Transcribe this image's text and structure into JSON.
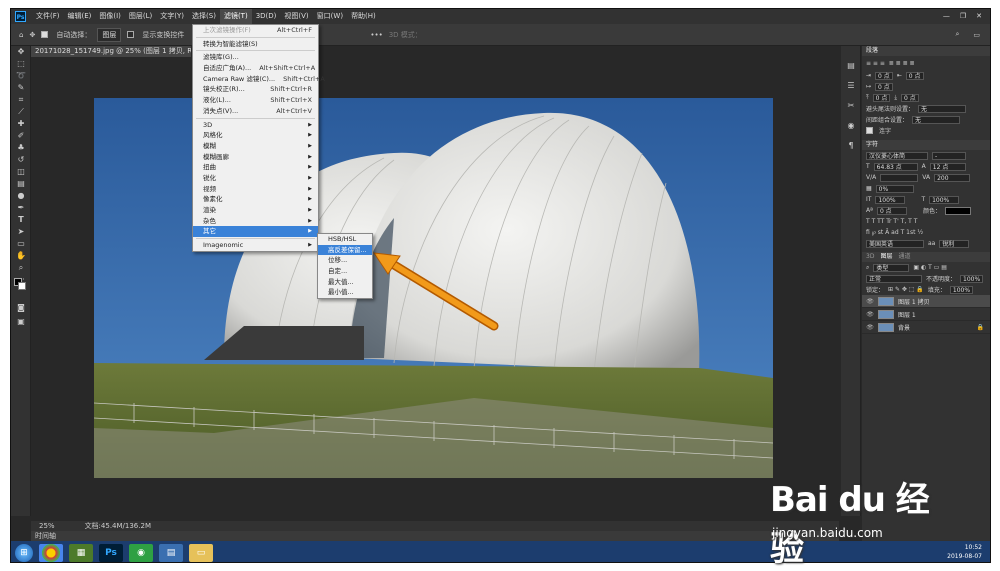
{
  "menubar": {
    "items": [
      "文件(F)",
      "编辑(E)",
      "图像(I)",
      "图层(L)",
      "文字(Y)",
      "选择(S)",
      "滤镜(T)",
      "3D(D)",
      "视图(V)",
      "窗口(W)",
      "帮助(H)"
    ],
    "active": "滤镜(T)"
  },
  "options": {
    "auto_select_label": "自动选择：",
    "auto_select_value": "图层",
    "transform_label": "显示变换控件",
    "mode_3d": "3D 模式："
  },
  "document": {
    "tab_title": "20171028_151749.jpg @ 25% (图层 1 拷贝, RGB/8) *",
    "zoom": "25%",
    "doc_info": "文档:45.4M/136.2M"
  },
  "timeline_label": "时间轴",
  "filter_menu": {
    "top": [
      {
        "label": "上次滤镜操作(F)",
        "shortcut": "Alt+Ctrl+F",
        "disabled": true
      },
      {
        "label": "转换为智能滤镜(S)",
        "shortcut": ""
      }
    ],
    "mid": [
      {
        "label": "滤镜库(G)...",
        "shortcut": ""
      },
      {
        "label": "自适应广角(A)...",
        "shortcut": "Alt+Shift+Ctrl+A"
      },
      {
        "label": "Camera Raw 滤镜(C)...",
        "shortcut": "Shift+Ctrl+A"
      },
      {
        "label": "镜头校正(R)...",
        "shortcut": "Shift+Ctrl+R"
      },
      {
        "label": "液化(L)...",
        "shortcut": "Shift+Ctrl+X"
      },
      {
        "label": "消失点(V)...",
        "shortcut": "Alt+Ctrl+V"
      }
    ],
    "groups": [
      "3D",
      "风格化",
      "模糊",
      "模糊画廊",
      "扭曲",
      "锐化",
      "视频",
      "像素化",
      "渲染",
      "杂色",
      "其它"
    ],
    "plugin": "Imagenomic"
  },
  "other_submenu": {
    "items": [
      "HSB/HSL",
      "高反差保留...",
      "位移...",
      "自定...",
      "最大值...",
      "最小值..."
    ],
    "highlighted": "高反差保留..."
  },
  "paragraph_panel": {
    "title": "段落",
    "fields": [
      "0 点",
      "0 点",
      "0 点",
      "0 点",
      "0 点"
    ],
    "hyphen_label": "避头尾法则设置：",
    "hyphen_value": "无",
    "spacing_label": "间距组合设置：",
    "spacing_value": "无",
    "auto_hyphen": "连字"
  },
  "character_panel": {
    "title": "字符",
    "font": "汉仪菱心体简",
    "style": "-",
    "size": "64.83 点",
    "leading": "12 点",
    "kerning": "",
    "tracking": "200",
    "scale_v": "0%",
    "scale_h_pct": "100%",
    "scale_w_pct": "100%",
    "baseline": "0 点",
    "color_label": "颜色：",
    "lang": "美国英语",
    "aa": "锐利"
  },
  "layers_panel": {
    "tabs": [
      "3D",
      "图层",
      "通道"
    ],
    "filter_label": "类型",
    "blend": "正常",
    "opacity_label": "不透明度：",
    "opacity": "100%",
    "lock_label": "锁定：",
    "fill_label": "填充：",
    "fill": "100%",
    "layers": [
      {
        "name": "图层 1 拷贝",
        "selected": true
      },
      {
        "name": "图层 1",
        "selected": false
      },
      {
        "name": "背景",
        "selected": false
      }
    ]
  },
  "taskbar": {
    "time": "10:52",
    "date": "2019-08-07"
  },
  "watermark": {
    "main": "Bai du 经验",
    "url": "jingyan.baidu.com"
  },
  "colors": {
    "accent": "#3a82d8",
    "arrow": "#f29a1a"
  }
}
